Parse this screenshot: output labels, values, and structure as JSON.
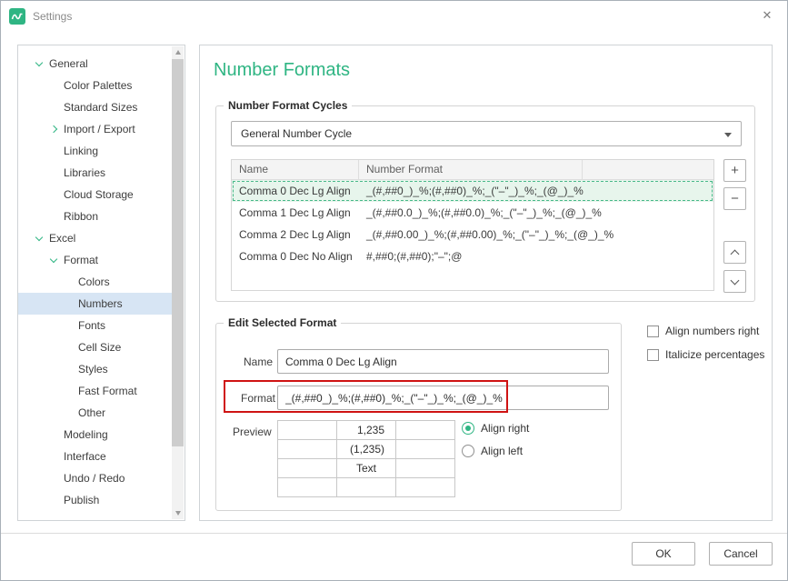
{
  "window": {
    "title": "Settings",
    "close_glyph": "✕"
  },
  "sidebar": {
    "items": [
      {
        "label": "General",
        "level": 1,
        "chevron": "down"
      },
      {
        "label": "Color Palettes",
        "level": 2
      },
      {
        "label": "Standard Sizes",
        "level": 2
      },
      {
        "label": "Import / Export",
        "level": 2,
        "chevron": "right"
      },
      {
        "label": "Linking",
        "level": 2
      },
      {
        "label": "Libraries",
        "level": 2
      },
      {
        "label": "Cloud Storage",
        "level": 2
      },
      {
        "label": "Ribbon",
        "level": 2
      },
      {
        "label": "Excel",
        "level": 1,
        "chevron": "down"
      },
      {
        "label": "Format",
        "level": 2,
        "chevron": "down"
      },
      {
        "label": "Colors",
        "level": 3
      },
      {
        "label": "Numbers",
        "level": 3,
        "selected": true
      },
      {
        "label": "Fonts",
        "level": 3
      },
      {
        "label": "Cell Size",
        "level": 3
      },
      {
        "label": "Styles",
        "level": 3
      },
      {
        "label": "Fast Format",
        "level": 3
      },
      {
        "label": "Other",
        "level": 3
      },
      {
        "label": "Modeling",
        "level": 2
      },
      {
        "label": "Interface",
        "level": 2
      },
      {
        "label": "Undo / Redo",
        "level": 2
      },
      {
        "label": "Publish",
        "level": 2
      }
    ]
  },
  "main": {
    "title": "Number Formats",
    "cycles": {
      "group_label": "Number Format Cycles",
      "dropdown_value": "General Number Cycle",
      "buttons": {
        "add": "+",
        "remove": "−"
      },
      "table": {
        "columns": [
          "Name",
          "Number Format"
        ],
        "rows": [
          {
            "name": "Comma 0 Dec Lg Align",
            "format": "_(#,##0_)_%;(#,##0)_%;_(\"–\"_)_%;_(@_)_%",
            "selected": true
          },
          {
            "name": "Comma 1 Dec Lg Align",
            "format": "_(#,##0.0_)_%;(#,##0.0)_%;_(\"–\"_)_%;_(@_)_%"
          },
          {
            "name": "Comma 2 Dec Lg Align",
            "format": "_(#,##0.00_)_%;(#,##0.00)_%;_(\"–\"_)_%;_(@_)_%"
          },
          {
            "name": "Comma 0 Dec No Align",
            "format": "#,##0;(#,##0);\"–\";@"
          }
        ]
      }
    },
    "edit": {
      "group_label": "Edit Selected Format",
      "name_label": "Name",
      "name_value": "Comma 0 Dec Lg Align",
      "format_label": "Format",
      "format_value": "_(#,##0_)_%;(#,##0)_%;_(\"–\"_)_%;_(@_)_%",
      "preview_label": "Preview",
      "preview_rows": [
        "1,235",
        "(1,235)",
        "Text"
      ],
      "align_right_label": "Align right",
      "align_left_label": "Align left"
    },
    "options": {
      "align_numbers_right": "Align numbers right",
      "italicize_percentages": "Italicize percentages"
    }
  },
  "footer": {
    "ok_label": "OK",
    "cancel_label": "Cancel"
  },
  "colors": {
    "accent": "#2fb583",
    "selected_row_bg": "#e7f5ec",
    "sidebar_selected_bg": "#d7e5f4",
    "annotation_red": "#cf1313"
  }
}
